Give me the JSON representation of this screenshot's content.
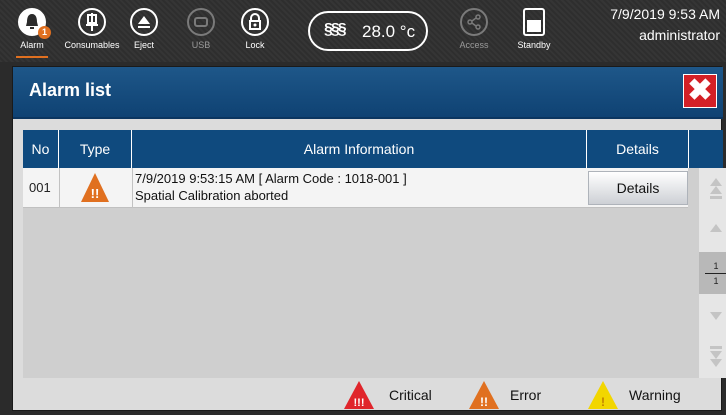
{
  "toolbar": {
    "alarm": {
      "label": "Alarm",
      "badge": "1"
    },
    "consumables": {
      "label": "Consumables"
    },
    "eject": {
      "label": "Eject"
    },
    "usb": {
      "label": "USB"
    },
    "lock": {
      "label": "Lock"
    },
    "temperature": {
      "value": "28.0 °c"
    },
    "access": {
      "label": "Access"
    },
    "standby": {
      "label": "Standby"
    },
    "datetime": "7/9/2019 9:53 AM",
    "user": "administrator"
  },
  "dialog": {
    "title": "Alarm list",
    "columns": [
      "No",
      "Type",
      "Alarm Information",
      "Details"
    ],
    "rows": [
      {
        "no": "001",
        "type": "Error",
        "info_line1": "7/9/2019 9:53:15 AM  [ Alarm Code : 1018-001 ]",
        "info_line2": "Spatial Calibration aborted",
        "details_label": "Details"
      }
    ],
    "page": {
      "current": "1",
      "total": "1"
    },
    "legend": [
      "Critical",
      "Error",
      "Warning"
    ]
  },
  "colors": {
    "header": "#0f4a7e",
    "critical": "#e0252b",
    "error": "#e07020",
    "warning": "#f2d600",
    "close": "#d42026"
  }
}
